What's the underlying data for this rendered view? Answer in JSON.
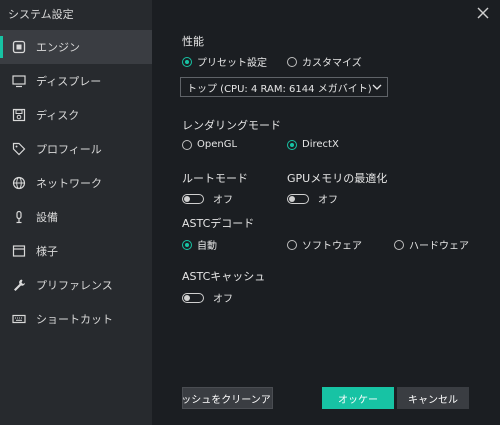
{
  "window": {
    "title": "システム設定"
  },
  "sidebar": {
    "items": [
      {
        "label": "エンジン",
        "icon": "engine-icon",
        "active": true
      },
      {
        "label": "ディスプレー",
        "icon": "monitor-icon",
        "active": false
      },
      {
        "label": "ディスク",
        "icon": "disk-icon",
        "active": false
      },
      {
        "label": "プロフィール",
        "icon": "tag-icon",
        "active": false
      },
      {
        "label": "ネットワーク",
        "icon": "globe-icon",
        "active": false
      },
      {
        "label": "設備",
        "icon": "mic-icon",
        "active": false
      },
      {
        "label": "様子",
        "icon": "window-icon",
        "active": false
      },
      {
        "label": "プリファレンス",
        "icon": "wrench-icon",
        "active": false
      },
      {
        "label": "ショートカット",
        "icon": "keyboard-icon",
        "active": false
      }
    ]
  },
  "performance": {
    "label": "性能",
    "options": [
      "プリセット設定",
      "カスタマイズ"
    ],
    "selected": "プリセット設定",
    "preset_value": "トップ (CPU: 4 RAM: 6144 メガバイト)"
  },
  "rendering": {
    "label": "レンダリングモード",
    "options": [
      "OpenGL",
      "DirectX"
    ],
    "selected": "DirectX"
  },
  "root": {
    "label": "ルートモード",
    "state": "オフ"
  },
  "gpu": {
    "label": "GPUメモリの最適化",
    "state": "オフ"
  },
  "astc_decode": {
    "label": "ASTCデコード",
    "options": [
      "自動",
      "ソフトウェア",
      "ハードウェア"
    ],
    "selected": "自動"
  },
  "astc_cache": {
    "label": "ASTCキャッシュ",
    "state": "オフ"
  },
  "buttons": {
    "clean_cache": "Cキャッシュをクリーンアップし",
    "ok": "オッケー",
    "cancel": "キャンセル"
  },
  "colors": {
    "accent": "#17c3a4",
    "sidebar": "#272a2e",
    "background": "#1b1e22"
  }
}
